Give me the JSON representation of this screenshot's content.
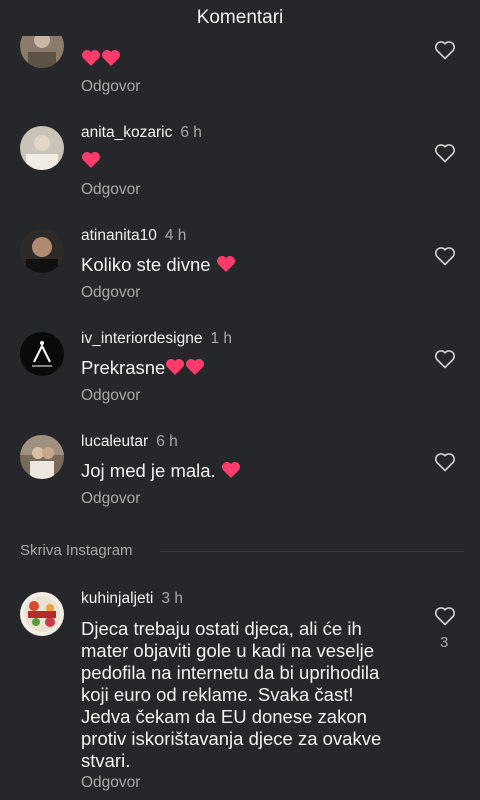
{
  "header": {
    "title": "Komentari"
  },
  "comments": [
    {
      "username": "",
      "time": "",
      "text": "",
      "reply": "Odgovor",
      "hearts": 2
    },
    {
      "username": "anita_kozaric",
      "time": "6 h",
      "text": "",
      "reply": "Odgovor",
      "hearts": 1
    },
    {
      "username": "atinanita10",
      "time": "4 h",
      "text": "Koliko ste divne",
      "reply": "Odgovor",
      "hearts": 1
    },
    {
      "username": "iv_interiordesigne",
      "time": "1 h",
      "text": "Prekrasne",
      "reply": "Odgovor",
      "hearts": 2
    },
    {
      "username": "lucaleutar",
      "time": "6 h",
      "text": "Joj med je mala.",
      "reply": "Odgovor",
      "hearts": 1
    }
  ],
  "hidden_section": {
    "label": "Skriva Instagram"
  },
  "hidden_comment": {
    "username": "kuhinjaljeti",
    "time": "3 h",
    "text_lines": [
      "Djeca trebaju ostati djeca, ali će ih",
      "mater objaviti gole u kadi na veselje",
      "pedofila na internetu da bi uprihodila",
      "koji euro od reklame. Svaka čast!",
      "Jedva čekam da EU donese zakon",
      "protiv iskorištavanja djece za ovakve",
      "stvari."
    ],
    "reply": "Odgovor",
    "like_count": "3"
  },
  "colors": {
    "background": "#25272b",
    "text_primary": "#f2f2f2",
    "text_secondary": "#a8a8a8",
    "emoji_heart": "#ff3b6b"
  },
  "icons": {
    "like": "heart-outline-icon",
    "emoji": "red-heart-emoji"
  }
}
